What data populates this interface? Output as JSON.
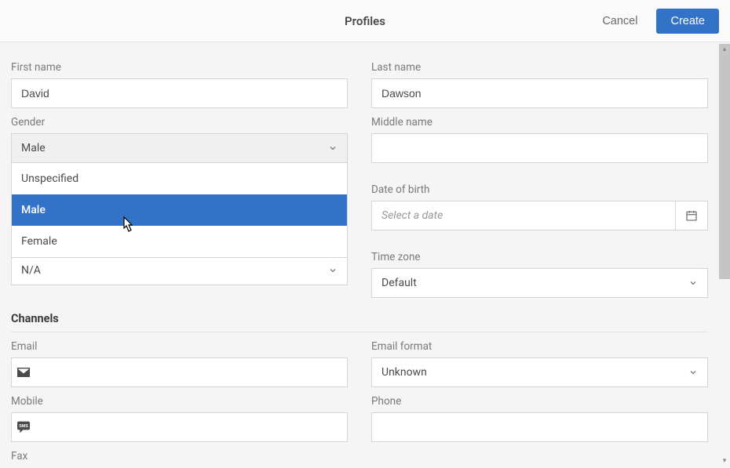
{
  "header": {
    "title": "Profiles",
    "cancel": "Cancel",
    "create": "Create"
  },
  "fields": {
    "first_name_label": "First name",
    "first_name_value": "David",
    "last_name_label": "Last name",
    "last_name_value": "Dawson",
    "gender_label": "Gender",
    "gender_value": "Male",
    "gender_options": [
      "Unspecified",
      "Male",
      "Female"
    ],
    "middle_name_label": "Middle name",
    "middle_name_value": "",
    "na_value": "N/A",
    "dob_label": "Date of birth",
    "dob_placeholder": "Select a date",
    "tz_label": "Time zone",
    "tz_value": "Default",
    "channels_title": "Channels",
    "email_label": "Email",
    "email_value": "",
    "email_format_label": "Email format",
    "email_format_value": "Unknown",
    "mobile_label": "Mobile",
    "mobile_value": "",
    "phone_label": "Phone",
    "phone_value": "",
    "fax_label": "Fax"
  }
}
